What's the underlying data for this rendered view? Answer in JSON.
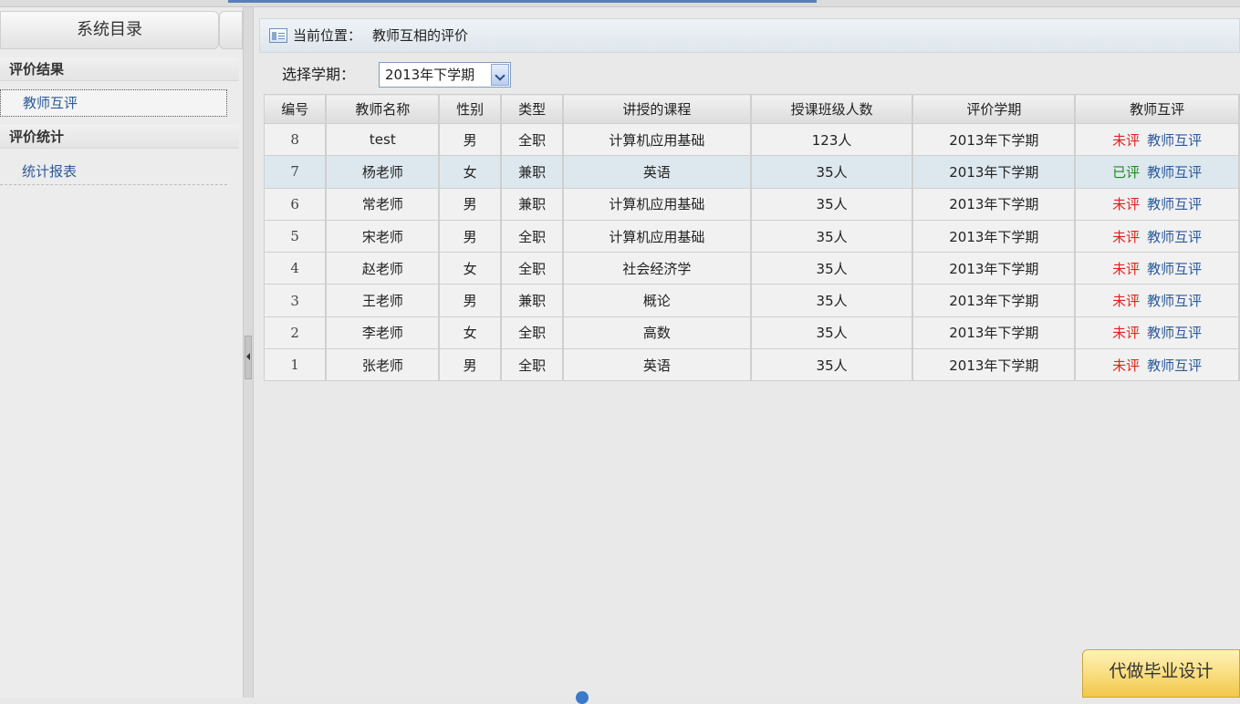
{
  "sidebar": {
    "title": "系统目录",
    "sections": [
      {
        "label": "评价结果",
        "items": [
          {
            "label": "教师互评",
            "active": true
          }
        ]
      },
      {
        "label": "评价统计",
        "items": [
          {
            "label": "统计报表",
            "active": false
          }
        ]
      }
    ]
  },
  "breadcrumb": {
    "prefix": "当前位置：",
    "page": "教师互相的评价"
  },
  "term": {
    "label": "选择学期：",
    "selected": "2013年下学期"
  },
  "table": {
    "headers": [
      "编号",
      "教师名称",
      "性别",
      "类型",
      "讲授的课程",
      "授课班级人数",
      "评价学期",
      "教师互评"
    ],
    "rows": [
      {
        "id": "8",
        "name": "test",
        "gender": "男",
        "type": "全职",
        "course": "计算机应用基础",
        "students": "123人",
        "term": "2013年下学期",
        "status": "未评",
        "action": "教师互评"
      },
      {
        "id": "7",
        "name": "杨老师",
        "gender": "女",
        "type": "兼职",
        "course": "英语",
        "students": "35人",
        "term": "2013年下学期",
        "status": "已评",
        "action": "教师互评"
      },
      {
        "id": "6",
        "name": "常老师",
        "gender": "男",
        "type": "兼职",
        "course": "计算机应用基础",
        "students": "35人",
        "term": "2013年下学期",
        "status": "未评",
        "action": "教师互评"
      },
      {
        "id": "5",
        "name": "宋老师",
        "gender": "男",
        "type": "全职",
        "course": "计算机应用基础",
        "students": "35人",
        "term": "2013年下学期",
        "status": "未评",
        "action": "教师互评"
      },
      {
        "id": "4",
        "name": "赵老师",
        "gender": "女",
        "type": "全职",
        "course": "社会经济学",
        "students": "35人",
        "term": "2013年下学期",
        "status": "未评",
        "action": "教师互评"
      },
      {
        "id": "3",
        "name": "王老师",
        "gender": "男",
        "type": "兼职",
        "course": "概论",
        "students": "35人",
        "term": "2013年下学期",
        "status": "未评",
        "action": "教师互评"
      },
      {
        "id": "2",
        "name": "李老师",
        "gender": "女",
        "type": "全职",
        "course": "高数",
        "students": "35人",
        "term": "2013年下学期",
        "status": "未评",
        "action": "教师互评"
      },
      {
        "id": "1",
        "name": "张老师",
        "gender": "男",
        "type": "全职",
        "course": "英语",
        "students": "35人",
        "term": "2013年下学期",
        "status": "未评",
        "action": "教师互评"
      }
    ]
  },
  "ad": {
    "text": "代做毕业设计"
  },
  "colors": {
    "not_rated": "#e02222",
    "rated": "#1d8a1d",
    "link": "#2c5a9c"
  }
}
